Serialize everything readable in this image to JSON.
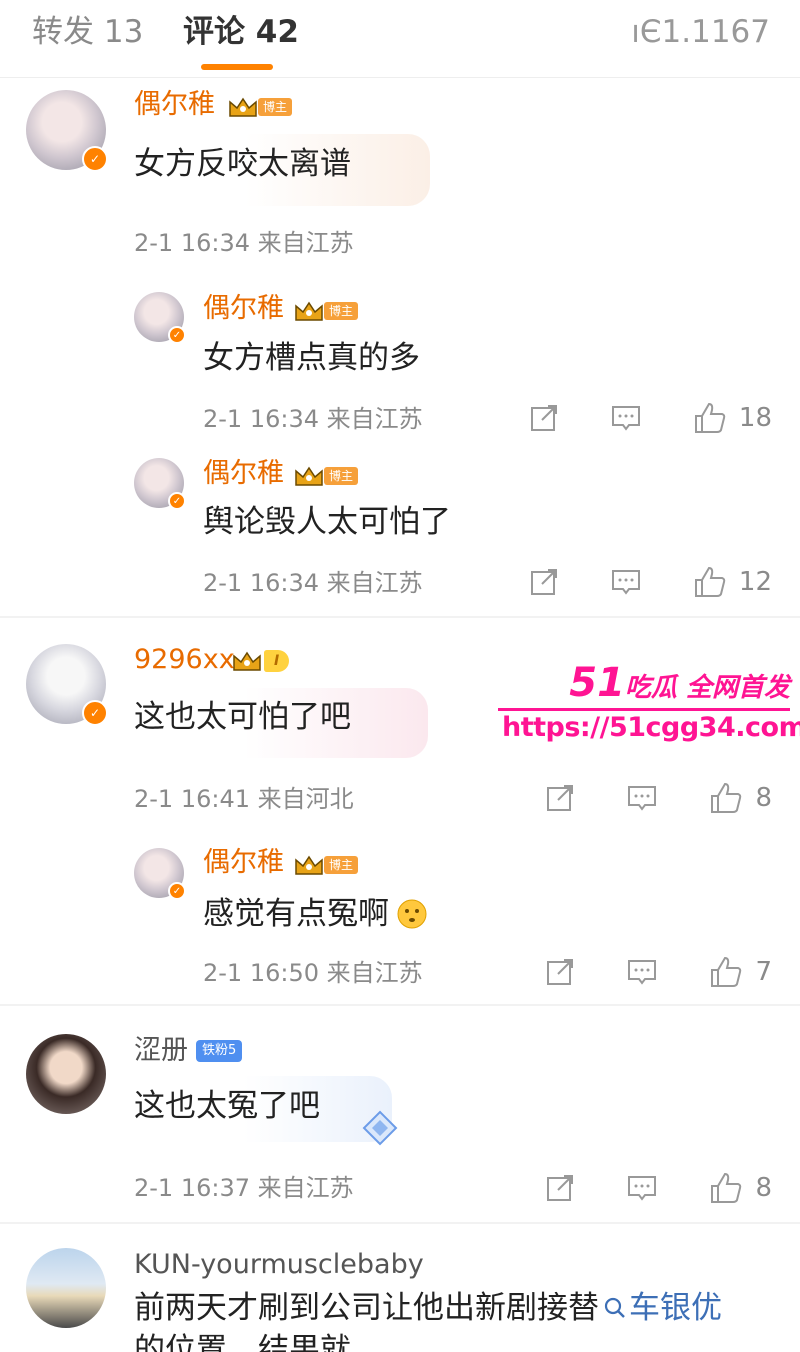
{
  "tabs": {
    "repost": "转发 13",
    "comments": "评论 42",
    "right": "ıЄ1.1167"
  },
  "badges": {
    "blogger": "博主",
    "fan": "铁粉5",
    "level": "I"
  },
  "comments": [
    {
      "user": "偶尔稚",
      "text": "女方反咬太离谱",
      "meta": "2-1 16:34 来自江苏"
    },
    {
      "user": "偶尔稚",
      "text": "女方槽点真的多",
      "meta": "2-1 16:34 来自江苏",
      "likes": "18"
    },
    {
      "user": "偶尔稚",
      "text": "舆论毁人太可怕了",
      "meta": "2-1 16:34 来自江苏",
      "likes": "12"
    },
    {
      "user": "9296xx",
      "text": "这也太可怕了吧",
      "meta": "2-1 16:41 来自河北",
      "likes": "8"
    },
    {
      "user": "偶尔稚",
      "text": "感觉有点冤啊",
      "meta": "2-1 16:50 来自江苏",
      "likes": "7"
    },
    {
      "user": "涩册",
      "text": "这也太冤了吧",
      "meta": "2-1 16:37 来自江苏",
      "likes": "8"
    },
    {
      "user": "KUN-yourmusclebaby",
      "text_line1": "前两天才刷到公司让他出新剧接替",
      "search": "车银优",
      "text_line2": "的位置，结果就"
    }
  ],
  "watermark": {
    "num": "51",
    "tagline": "吃瓜 全网首发",
    "url": "https://51cgg34.com"
  },
  "colors": {
    "accent": "#ff8200",
    "username": "#e86b00",
    "watermark": "#ff1493"
  },
  "icons": [
    "repost-icon",
    "comment-icon",
    "like-icon",
    "verified-icon",
    "crown-icon",
    "search-icon"
  ]
}
